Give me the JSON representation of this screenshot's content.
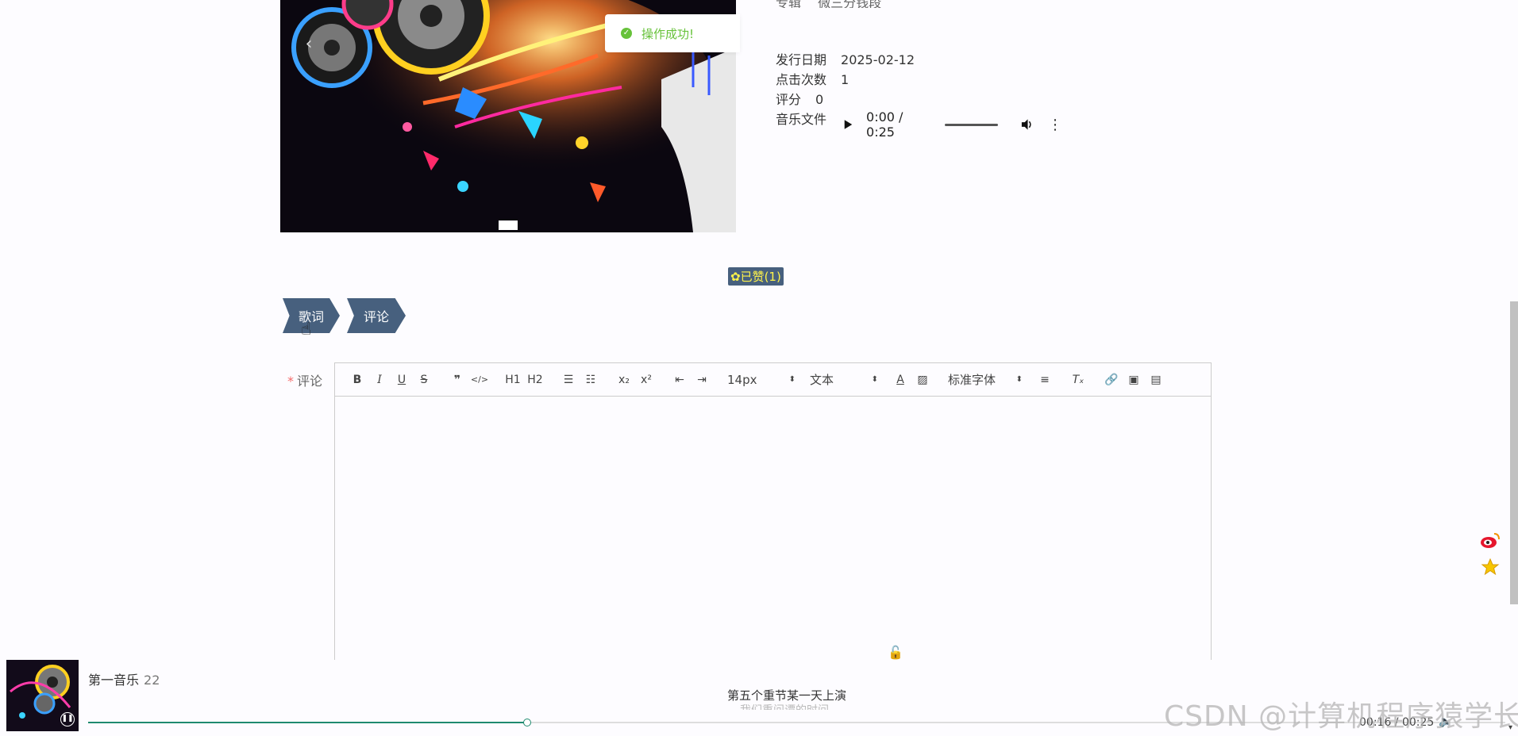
{
  "info": {
    "cut_row1_label": "专辑",
    "cut_row1_value": "微三分钱段",
    "release_date_label": "发行日期",
    "release_date": "2025-02-12",
    "clicks_label": "点击次数",
    "clicks": "1",
    "score_label": "评分",
    "score": "0",
    "music_file_label": "音乐文件"
  },
  "audio": {
    "time": "0:00 / 0:25"
  },
  "toast": {
    "message": "操作成功!"
  },
  "like": {
    "label": "已赞(1)"
  },
  "tabs": [
    {
      "label": "歌词"
    },
    {
      "label": "评论"
    }
  ],
  "comment": {
    "required_mark": "*",
    "label": "评论"
  },
  "editor": {
    "toolbar": {
      "size_value": "14px",
      "format_value": "文本",
      "font_value": "标准字体",
      "h1": "H1",
      "h2": "H2"
    }
  },
  "player": {
    "title": "第一音乐",
    "track_no": "22",
    "lyric_current": "第五个重节某一天上演",
    "lyric_next": "我们重问谭的时间",
    "time": "00:16 / 00:25",
    "progress": 0.31
  },
  "watermark": "CSDN @计算机程序猿学长",
  "colors": {
    "accent": "#47607e",
    "success": "#67c23a",
    "progress": "#1f8a6f"
  }
}
